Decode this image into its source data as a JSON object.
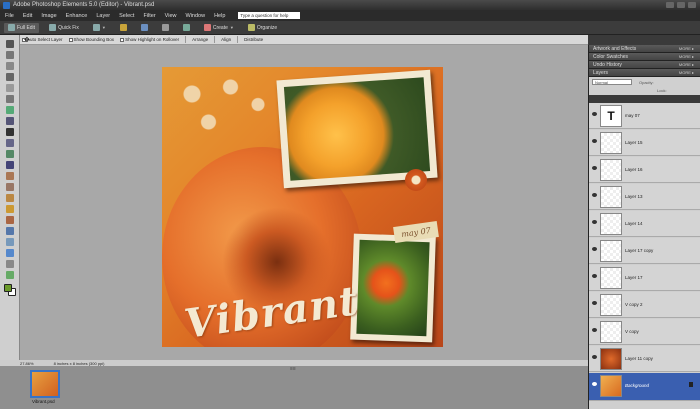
{
  "window": {
    "title": "Adobe Photoshop Elements 5.0 (Editor) - Vibrant.psd"
  },
  "menu": {
    "items": [
      "File",
      "Edit",
      "Image",
      "Enhance",
      "Layer",
      "Select",
      "Filter",
      "View",
      "Window",
      "Help"
    ],
    "help_placeholder": "Type a question for help"
  },
  "shortcuts": {
    "full_edit": "Full Edit",
    "quick_fix": "Quick Fix",
    "create": "Create",
    "organize": "Organize"
  },
  "options": {
    "auto_select_layer": "Auto Select Layer",
    "show_bounding_box": "Show Bounding Box",
    "show_highlight": "Show Highlight on Rollover",
    "arrange": "Arrange",
    "align": "Align",
    "distribute": "Distribute"
  },
  "document": {
    "tag_text": "may 07",
    "title_text": "Vibrant"
  },
  "status": {
    "zoom": "27.86%",
    "doc_size": "8 inches x 8 inches (300 ppi)"
  },
  "project_bin": {
    "file_label": "Vibrant.psd"
  },
  "palette": {
    "panels": [
      {
        "label": "Artwork and Effects",
        "more": "MORE ▸"
      },
      {
        "label": "Color Swatches",
        "more": "MORE ▸"
      },
      {
        "label": "Undo History",
        "more": "MORE ▸"
      },
      {
        "label": "Layers",
        "more": "MORE ▸"
      }
    ],
    "blend_mode": "Normal",
    "opacity_label": "Opacity:",
    "lock_label": "Lock:",
    "layers": [
      {
        "name": "may 07",
        "thumb": "text"
      },
      {
        "name": "Layer 15",
        "thumb": "transparent"
      },
      {
        "name": "Layer 16",
        "thumb": "transparent"
      },
      {
        "name": "Layer 13",
        "thumb": "transparent"
      },
      {
        "name": "Layer 14",
        "thumb": "transparent"
      },
      {
        "name": "Layer 17 copy",
        "thumb": "transparent"
      },
      {
        "name": "Layer 17",
        "thumb": "transparent"
      },
      {
        "name": "V copy 2",
        "thumb": "transparent"
      },
      {
        "name": "V copy",
        "thumb": "transparent"
      },
      {
        "name": "Layer 11 copy",
        "thumb": "image"
      },
      {
        "name": "Background",
        "thumb": "background",
        "selected": true,
        "locked": true
      }
    ]
  },
  "colors": {
    "accent_blue": "#3a5fb0",
    "foreground_swatch": "#6b9a2a",
    "background_swatch": "#ffffff"
  }
}
